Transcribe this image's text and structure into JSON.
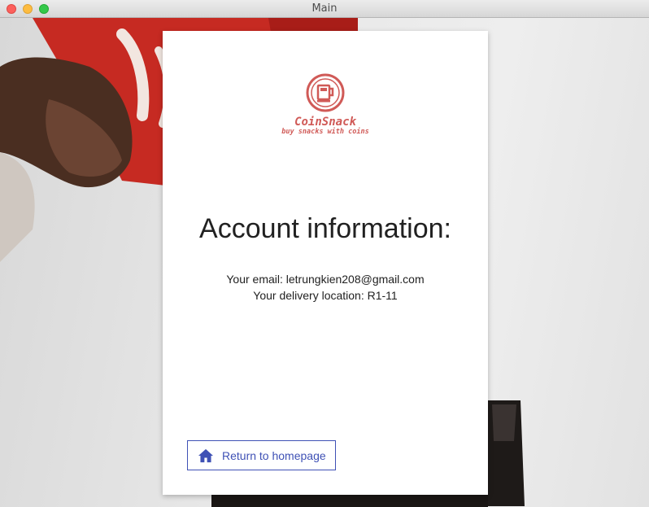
{
  "window": {
    "title": "Main"
  },
  "brand": {
    "name": "CoinSnack",
    "tagline": "buy snacks with coins",
    "color": "#d05a57"
  },
  "account": {
    "heading": "Account information:",
    "email_line": "Your email: letrungkien208@gmail.com",
    "location_line": "Your delivery location: R1-11"
  },
  "actions": {
    "return_label": "Return to homepage",
    "return_icon": "home-icon",
    "accent": "#3f51b5"
  }
}
